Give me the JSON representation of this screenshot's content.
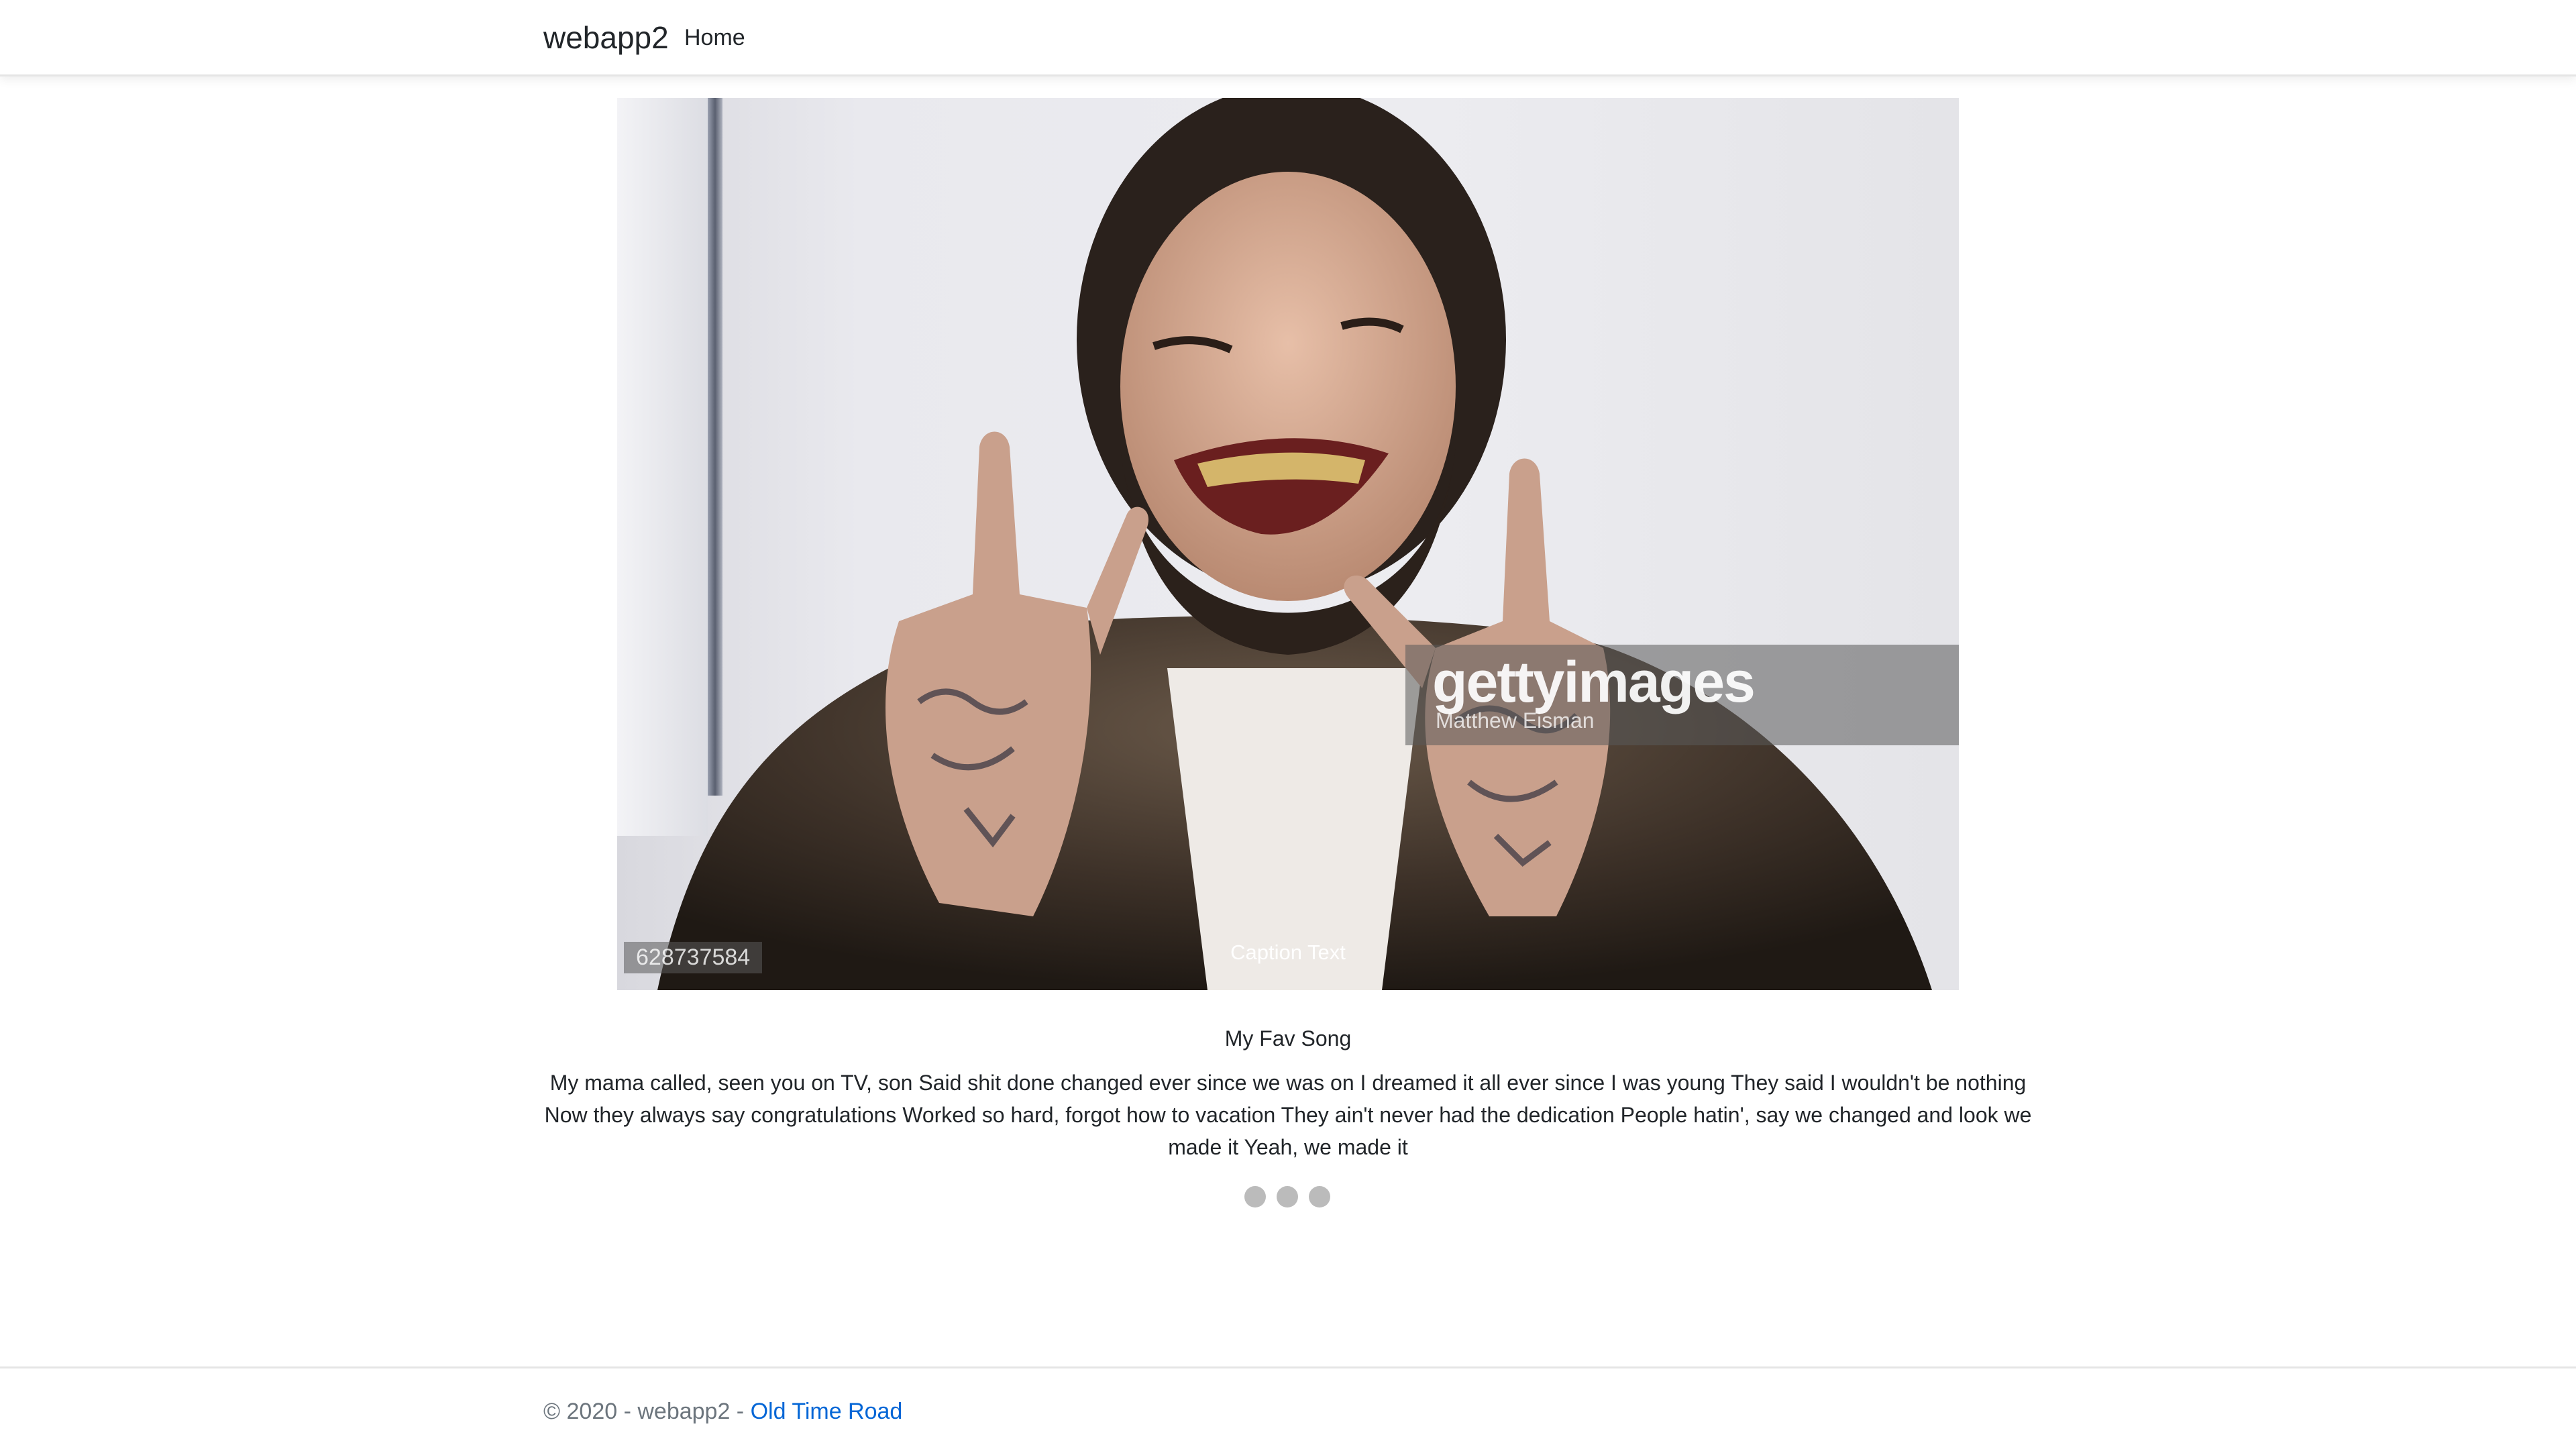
{
  "navbar": {
    "brand": "webapp2",
    "links": [
      {
        "label": "Home"
      }
    ]
  },
  "slideshow": {
    "caption": "Caption Text",
    "image": {
      "watermark_logo": "gettyimages",
      "watermark_credit": "Matthew Eisman",
      "image_id": "628737584"
    },
    "dots_count": 3
  },
  "content": {
    "title": "My Fav Song",
    "lyrics": "My mama called, seen you on TV, son Said shit done changed ever since we was on I dreamed it all ever since I was young They said I wouldn't be nothing Now they always say congratulations Worked so hard, forgot how to vacation They ain't never had the dedication People hatin', say we changed and look we made it Yeah, we made it"
  },
  "footer": {
    "copyright": "© 2020 - webapp2 - ",
    "link_label": "Old Time Road"
  },
  "colors": {
    "link": "#0366d6",
    "dot": "#bbbbbb",
    "footer_text": "#6c757d"
  }
}
